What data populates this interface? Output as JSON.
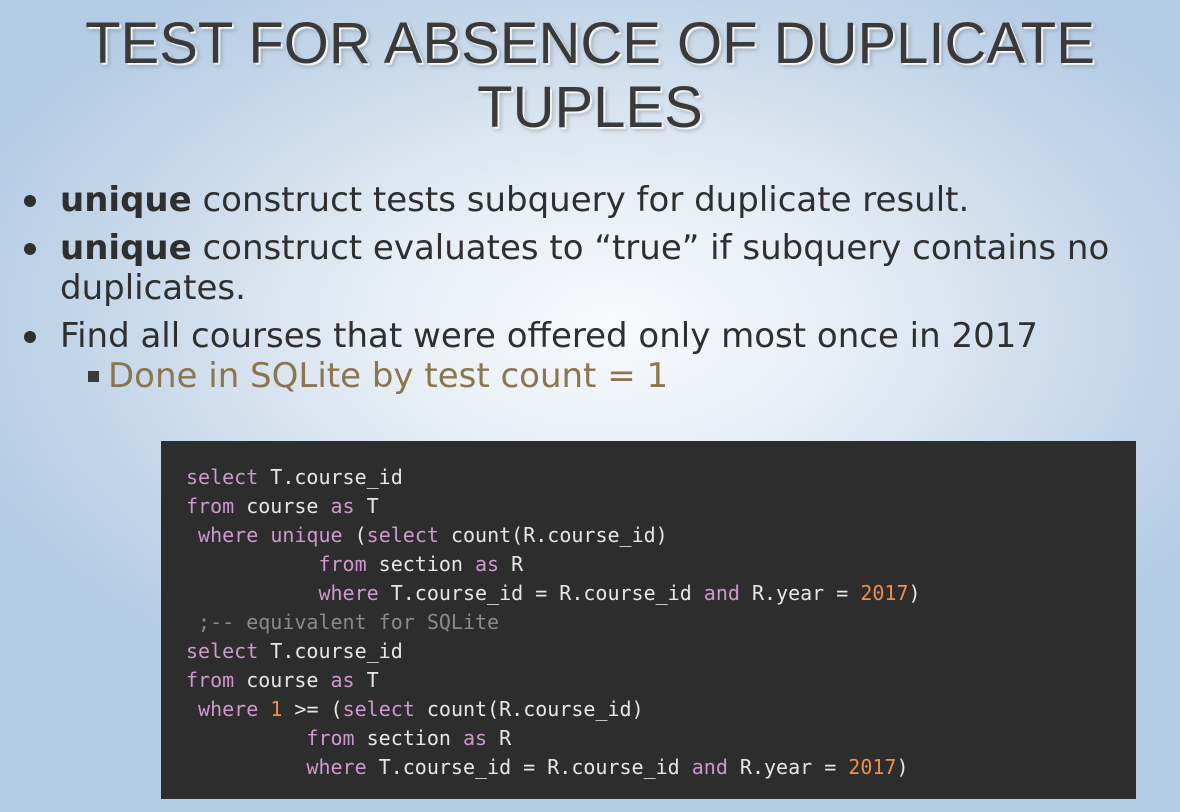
{
  "slide": {
    "title_line1": "TEST FOR ABSENCE OF DUPLICATE",
    "title_line2": "TUPLES"
  },
  "bullets": [
    {
      "keyword": "unique",
      "text": " construct tests subquery for duplicate result."
    },
    {
      "keyword": "unique",
      "text": " construct evaluates to “true” if subquery contains no duplicates."
    },
    {
      "keyword": "",
      "text": "Find all courses that were offered only most once in 2017"
    }
  ],
  "sub_bullet": {
    "text": "Done in SQLite by test count = 1"
  },
  "colors": {
    "code_background": "#2d2d2d",
    "keyword": "#cc99cd",
    "number": "#f08d49",
    "comment": "#8a8a8a",
    "identifier": "#e6e6e6",
    "sub_bullet_text": "#8a7650"
  },
  "code": [
    [
      {
        "t": "select",
        "k": "kw"
      },
      {
        "t": " T.course_id",
        "k": "id"
      }
    ],
    [
      {
        "t": "from",
        "k": "kw"
      },
      {
        "t": " course ",
        "k": "id"
      },
      {
        "t": "as",
        "k": "kw"
      },
      {
        "t": " T",
        "k": "id"
      }
    ],
    [
      {
        "t": " ",
        "k": "id"
      },
      {
        "t": "where",
        "k": "kw"
      },
      {
        "t": " ",
        "k": "id"
      },
      {
        "t": "unique",
        "k": "kw"
      },
      {
        "t": " (",
        "k": "id"
      },
      {
        "t": "select",
        "k": "kw"
      },
      {
        "t": " count(R.course_id)",
        "k": "id"
      }
    ],
    [
      {
        "t": "           ",
        "k": "id"
      },
      {
        "t": "from",
        "k": "kw"
      },
      {
        "t": " section ",
        "k": "id"
      },
      {
        "t": "as",
        "k": "kw"
      },
      {
        "t": " R",
        "k": "id"
      }
    ],
    [
      {
        "t": "           ",
        "k": "id"
      },
      {
        "t": "where",
        "k": "kw"
      },
      {
        "t": " T.course_id = R.course_id ",
        "k": "id"
      },
      {
        "t": "and",
        "k": "kw"
      },
      {
        "t": " R.year = ",
        "k": "id"
      },
      {
        "t": "2017",
        "k": "num"
      },
      {
        "t": ")",
        "k": "id"
      }
    ],
    [
      {
        "t": " ;-- equivalent for SQLite",
        "k": "cm"
      }
    ],
    [
      {
        "t": "select",
        "k": "kw"
      },
      {
        "t": " T.course_id",
        "k": "id"
      }
    ],
    [
      {
        "t": "from",
        "k": "kw"
      },
      {
        "t": " course ",
        "k": "id"
      },
      {
        "t": "as",
        "k": "kw"
      },
      {
        "t": " T",
        "k": "id"
      }
    ],
    [
      {
        "t": " ",
        "k": "id"
      },
      {
        "t": "where",
        "k": "kw"
      },
      {
        "t": " ",
        "k": "id"
      },
      {
        "t": "1",
        "k": "num"
      },
      {
        "t": " >= (",
        "k": "id"
      },
      {
        "t": "select",
        "k": "kw"
      },
      {
        "t": " count(R.course_id)",
        "k": "id"
      }
    ],
    [
      {
        "t": "          ",
        "k": "id"
      },
      {
        "t": "from",
        "k": "kw"
      },
      {
        "t": " section ",
        "k": "id"
      },
      {
        "t": "as",
        "k": "kw"
      },
      {
        "t": " R",
        "k": "id"
      }
    ],
    [
      {
        "t": "          ",
        "k": "id"
      },
      {
        "t": "where",
        "k": "kw"
      },
      {
        "t": " T.course_id = R.course_id ",
        "k": "id"
      },
      {
        "t": "and",
        "k": "kw"
      },
      {
        "t": " R.year = ",
        "k": "id"
      },
      {
        "t": "2017",
        "k": "num"
      },
      {
        "t": ")",
        "k": "id"
      }
    ]
  ]
}
